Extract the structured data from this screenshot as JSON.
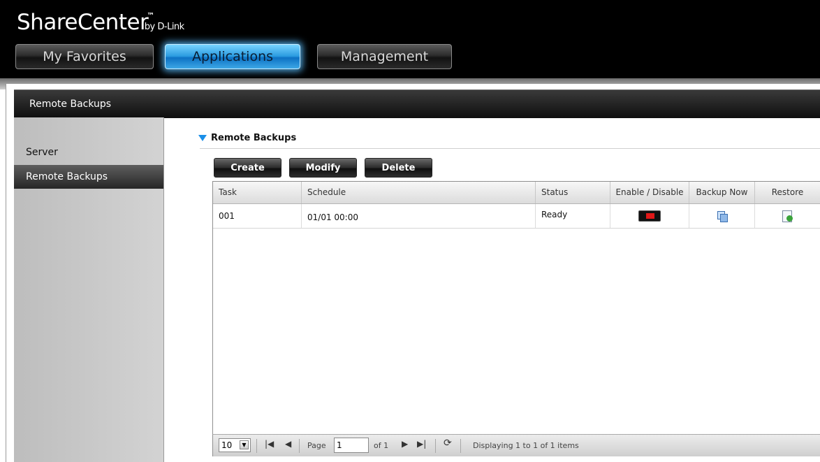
{
  "brand": {
    "name": "ShareCenter",
    "tm": "™",
    "by": "by D-Link"
  },
  "nav": {
    "tabs": [
      "My Favorites",
      "Applications",
      "Management"
    ],
    "active": "Applications"
  },
  "page": {
    "title": "Remote Backups"
  },
  "sidebar": {
    "items": [
      {
        "label": "Server"
      },
      {
        "label": "Remote Backups"
      }
    ],
    "selected": "Remote Backups"
  },
  "section": {
    "title": "Remote Backups"
  },
  "toolbar": {
    "create": "Create",
    "modify": "Modify",
    "delete": "Delete"
  },
  "table": {
    "columns": [
      "Task",
      "Schedule",
      "Status",
      "Enable / Disable",
      "Backup Now",
      "Restore"
    ],
    "rows": [
      {
        "task": "001",
        "schedule": "01/01 00:00",
        "status": "Ready"
      }
    ]
  },
  "pager": {
    "page_size": "10",
    "page_label": "Page",
    "page_value": "1",
    "of_label": "of 1",
    "display": "Displaying 1 to 1 of 1 items"
  },
  "colors": {
    "active_tab": "#2b9be0",
    "section_marker": "#1a8fe8",
    "toggle_indicator": "#e01818"
  }
}
